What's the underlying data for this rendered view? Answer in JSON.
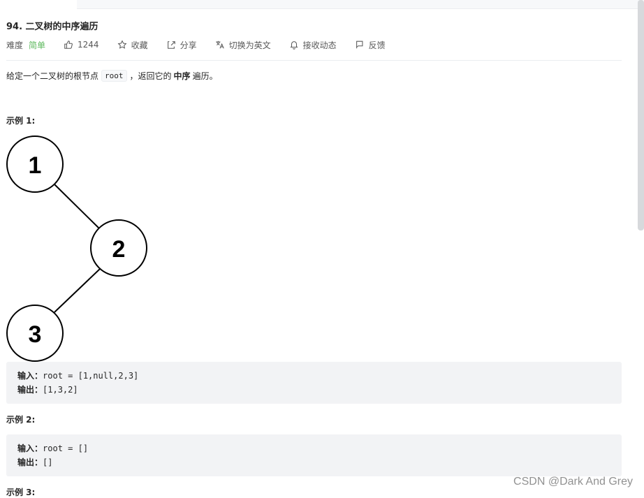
{
  "problem": {
    "title": "94. 二叉树的中序遍历",
    "difficulty_label": "难度",
    "difficulty_value": "简单",
    "likes": "1244",
    "favorite_label": "收藏",
    "share_label": "分享",
    "switch_lang_label": "切换为英文",
    "subscribe_label": "接收动态",
    "feedback_label": "反馈"
  },
  "description": {
    "prefix": "给定一个二叉树的根节点",
    "code": "root",
    "comma": "，",
    "middle": "返回它的",
    "bold": "中序",
    "suffix": "遍历。"
  },
  "examples": [
    {
      "heading": "示例 1:",
      "input_label": "输入：",
      "input_value": "root = [1,null,2,3]",
      "output_label": "输出：",
      "output_value": "[1,3,2]",
      "tree_nodes": [
        "1",
        "2",
        "3"
      ]
    },
    {
      "heading": "示例 2:",
      "input_label": "输入：",
      "input_value": "root = []",
      "output_label": "输出：",
      "output_value": "[]"
    },
    {
      "heading": "示例 3:"
    }
  ],
  "watermark": "CSDN @Dark And Grey",
  "colors": {
    "easy": "#5cb85c",
    "code_bg": "#f2f3f5",
    "text": "#262626"
  }
}
